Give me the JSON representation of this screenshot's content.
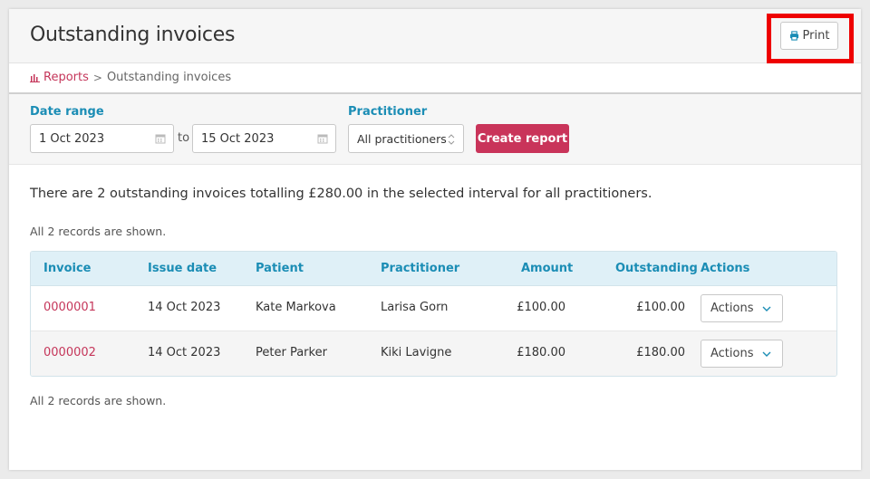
{
  "header": {
    "title": "Outstanding invoices",
    "print_label": "Print"
  },
  "breadcrumb": {
    "root": "Reports",
    "separator": ">",
    "current": "Outstanding invoices"
  },
  "filter": {
    "date_range_label": "Date range",
    "date_from": "1 Oct 2023",
    "to_label": "to",
    "date_to": "15 Oct 2023",
    "practitioner_label": "Practitioner",
    "practitioner_value": "All practitioners",
    "create_label": "Create report"
  },
  "summary": "There are 2 outstanding invoices totalling £280.00 in the selected interval for all practitioners.",
  "records_top": "All 2 records are shown.",
  "records_bottom": "All 2 records are shown.",
  "table": {
    "columns": [
      "Invoice",
      "Issue date",
      "Patient",
      "Practitioner",
      "Amount",
      "Outstanding",
      "Actions"
    ],
    "rows": [
      {
        "invoice": "0000001",
        "issue_date": "14 Oct 2023",
        "patient": "Kate Markova",
        "practitioner": "Larisa Gorn",
        "amount": "£100.00",
        "outstanding": "£100.00",
        "action": "Actions"
      },
      {
        "invoice": "0000002",
        "issue_date": "14 Oct 2023",
        "patient": "Peter Parker",
        "practitioner": "Kiki Lavigne",
        "amount": "£180.00",
        "outstanding": "£180.00",
        "action": "Actions"
      }
    ]
  },
  "colors": {
    "accent": "#c9345a",
    "link": "#c5365a",
    "header_text": "#1b8db5",
    "table_head": "#dff0f7",
    "highlight": "#ee0000"
  },
  "icons": {
    "print": "printer-icon",
    "reports": "bar-chart-icon",
    "calendar": "calendar-icon",
    "select": "updown-arrows-icon",
    "dropdown": "chevron-down-icon"
  }
}
